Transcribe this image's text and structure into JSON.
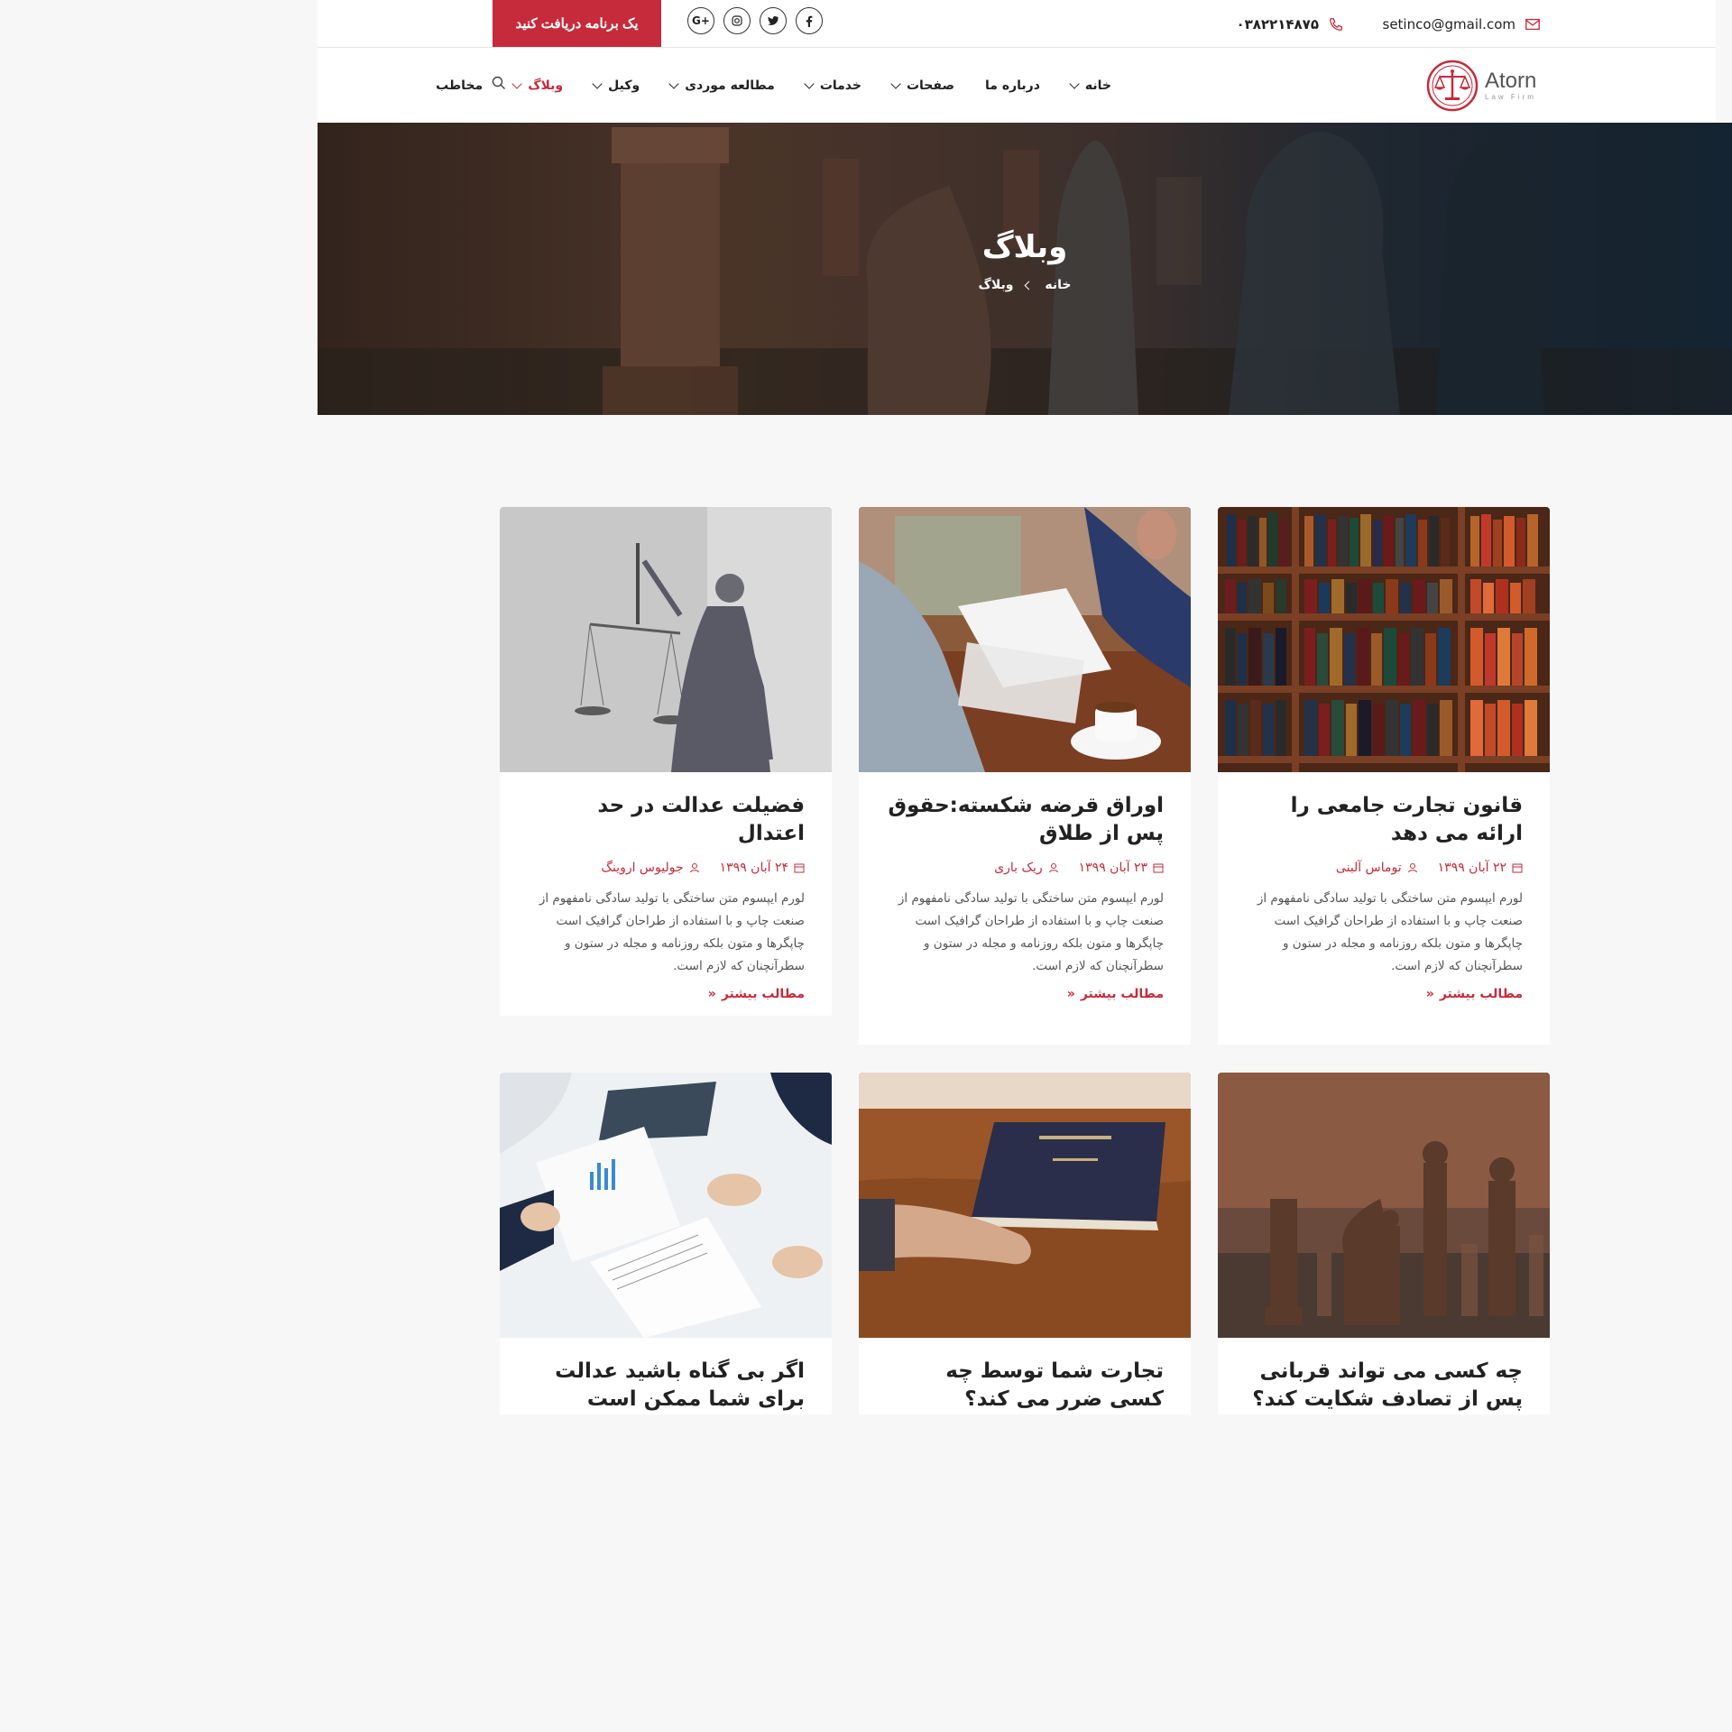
{
  "topbar": {
    "email": "setinco@gmail.com",
    "phone": "۰۳۸۲۲۱۴۸۷۵",
    "cta_label": "یک برنامه دریافت کنید",
    "socials": [
      "G+",
      "instagram-icon",
      "twitter-icon",
      "facebook-icon"
    ]
  },
  "nav": {
    "logo_main": "Atorn",
    "logo_sub": "Law Firm",
    "items": [
      {
        "label": "خانه"
      },
      {
        "label": "درباره ما"
      },
      {
        "label": "صفحات"
      },
      {
        "label": "خدمات"
      },
      {
        "label": "مطالعه موردی"
      },
      {
        "label": "وکیل"
      },
      {
        "label": "وبلاگ"
      },
      {
        "label": "مخاطب"
      }
    ]
  },
  "hero": {
    "title": "وبلاگ",
    "breadcrumb": [
      "خانه",
      "وبلاگ"
    ]
  },
  "posts": [
    {
      "title": "قانون تجارت جامعی را ارائه می دهد",
      "date": "۲۲ آبان ۱۳۹۹",
      "author": "توماس آلبنی",
      "excerpt": "لورم ایپسوم متن ساختگی با تولید سادگی نامفهوم از صنعت چاپ و با استفاده از طراحان گرافیک است چاپگرها و متون بلکه روزنامه و مجله در ستون و سطرآنچنان که لازم است.",
      "more": "مطالب بیشتر"
    },
    {
      "title": "اوراق قرضه شکسته:حقوق پس از طلاق",
      "date": "۲۳ آبان ۱۳۹۹",
      "author": "ریک باری",
      "excerpt": "لورم ایپسوم متن ساختگی با تولید سادگی نامفهوم از صنعت چاپ و با استفاده از طراحان گرافیک است چاپگرها و متون بلکه روزنامه و مجله در ستون و سطرآنچنان که لازم است.",
      "more": "مطالب بیشتر"
    },
    {
      "title": "فضیلت عدالت در حد اعتدال",
      "date": "۲۴ آبان ۱۳۹۹",
      "author": "جولیوس اروینگ",
      "excerpt": "لورم ایپسوم متن ساختگی با تولید سادگی نامفهوم از صنعت چاپ و با استفاده از طراحان گرافیک است چاپگرها و متون بلکه روزنامه و مجله در ستون و سطرآنچنان که لازم است.",
      "more": "مطالب بیشتر"
    },
    {
      "title": "چه کسی می تواند قربانی پس از تصادف شکایت کند؟"
    },
    {
      "title": "تجارت شما توسط چه کسی ضرر می کند؟"
    },
    {
      "title": "اگر بی گناه باشید عدالت برای شما ممکن است"
    }
  ],
  "colors": {
    "accent": "#c62b3b"
  }
}
